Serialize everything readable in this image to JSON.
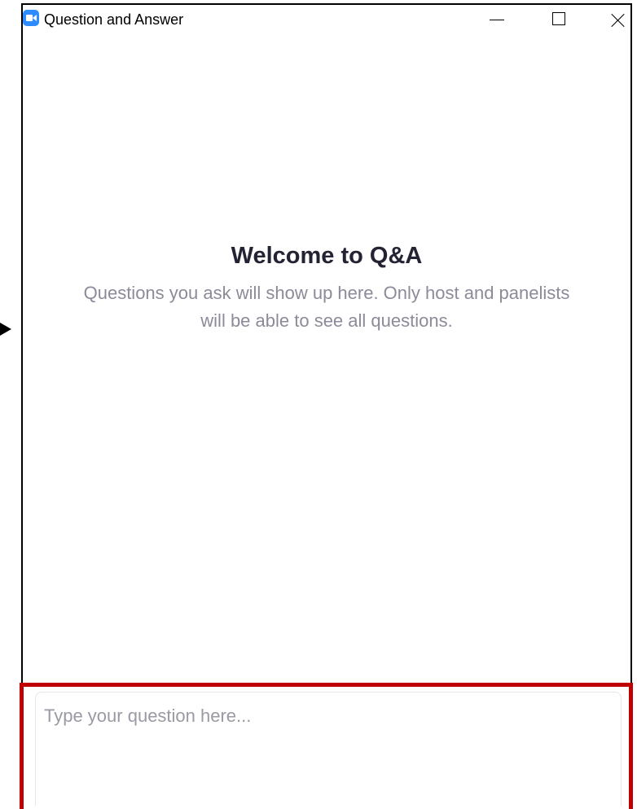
{
  "window": {
    "title": "Question and Answer",
    "app_icon": "zoom-camera-icon",
    "controls": {
      "minimize": "minimize-icon",
      "maximize": "maximize-icon",
      "close": "close-icon"
    }
  },
  "welcome": {
    "title": "Welcome to Q&A",
    "description": "Questions you ask will show up here. Only host and panelists will be able to see all questions."
  },
  "question_box": {
    "value": "",
    "placeholder": "Type your question here..."
  },
  "colors": {
    "highlight": "#C00000",
    "brand": "#2D8CFF",
    "title_text": "#232333",
    "muted_text": "#8b8b99"
  }
}
